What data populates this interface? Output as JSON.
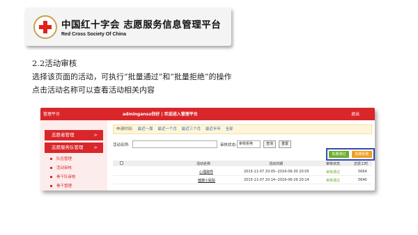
{
  "banner": {
    "title": "中国红十字会 志愿服务信息管理平台",
    "subtitle": "Red Cross Society Of China"
  },
  "section": {
    "title": "2.2活动审核",
    "lines": [
      "选择该页面的活动，可执行“批量通过”和“批量拒绝”的操作",
      "点击活动名称可以查看活动相关内容"
    ]
  },
  "app": {
    "brand": "管理平台",
    "user_line": "admingansu你好  |  欢迎进入管理平台",
    "logout": "退出",
    "sidebar": [
      {
        "label": "志愿者管理",
        "chevron": ">"
      },
      {
        "label": "志愿服务队管理",
        "chevron": ">"
      }
    ],
    "sidebar_sub": [
      "队伍管理",
      "活动审核",
      "骨干队审核",
      "骨干管理"
    ],
    "filters": {
      "label": "申请时间:",
      "links": [
        "最近一周",
        "最近一个月",
        "最近三个月",
        "最近半年",
        "全部"
      ]
    },
    "search": {
      "name_label": "活动名称:",
      "status_label": "审核状态:",
      "status_value": "审核拒绝",
      "query": "查询",
      "reset": "重置"
    },
    "batch": {
      "approve": "批量通过",
      "reject": "批量拒绝"
    },
    "table": {
      "columns": [
        "活动名称",
        "活动日期",
        "审核状态",
        "志愿工时"
      ],
      "rows": [
        {
          "name": "心理疏导",
          "date": "2015-11-07 20:05--2016-06-30 20:05",
          "status": "审核通过",
          "hours": "5664"
        },
        {
          "name": "健康小贴贴",
          "date": "2015-11-07 20:14--2016-06-29 20:14",
          "status": "审核通过",
          "hours": "5640"
        }
      ]
    }
  },
  "colors": {
    "brand_red": "#d9262a",
    "approve_green": "#6cae2a",
    "reject_orange": "#f0a020",
    "highlight_blue": "#3448b3"
  }
}
